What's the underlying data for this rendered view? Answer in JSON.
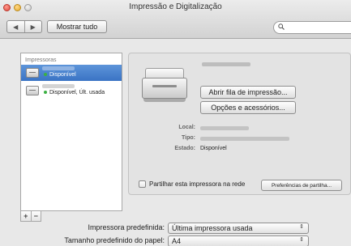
{
  "window": {
    "title": "Impressão e Digitalização"
  },
  "toolbar": {
    "back_glyph": "◀",
    "forward_glyph": "▶",
    "show_all_label": "Mostrar tudo",
    "search_placeholder": "",
    "search_icon": "search-icon"
  },
  "printer_list": {
    "header": "Impressoras",
    "items": [
      {
        "status": "Disponível",
        "selected": true,
        "status_color": "#3cb043"
      },
      {
        "status": "Disponível, Últ. usada",
        "selected": false,
        "status_color": "#3cb043"
      }
    ],
    "add_label": "+",
    "remove_label": "−"
  },
  "details": {
    "open_queue_label": "Abrir fila de impressão...",
    "options_label": "Opções e acessórios...",
    "location_label": "Local:",
    "type_label": "Tipo:",
    "status_label": "Estado:",
    "status_value": "Disponível",
    "share_label": "Partilhar esta impressora na rede",
    "share_checked": false,
    "share_prefs_label": "Preferências de partilha..."
  },
  "defaults": {
    "default_printer_label": "Impressora predefinida:",
    "default_printer_value": "Última impressora usada",
    "paper_size_label": "Tamanho predefinido do papel:",
    "paper_size_value": "A4",
    "select_arrows": "⇕"
  }
}
